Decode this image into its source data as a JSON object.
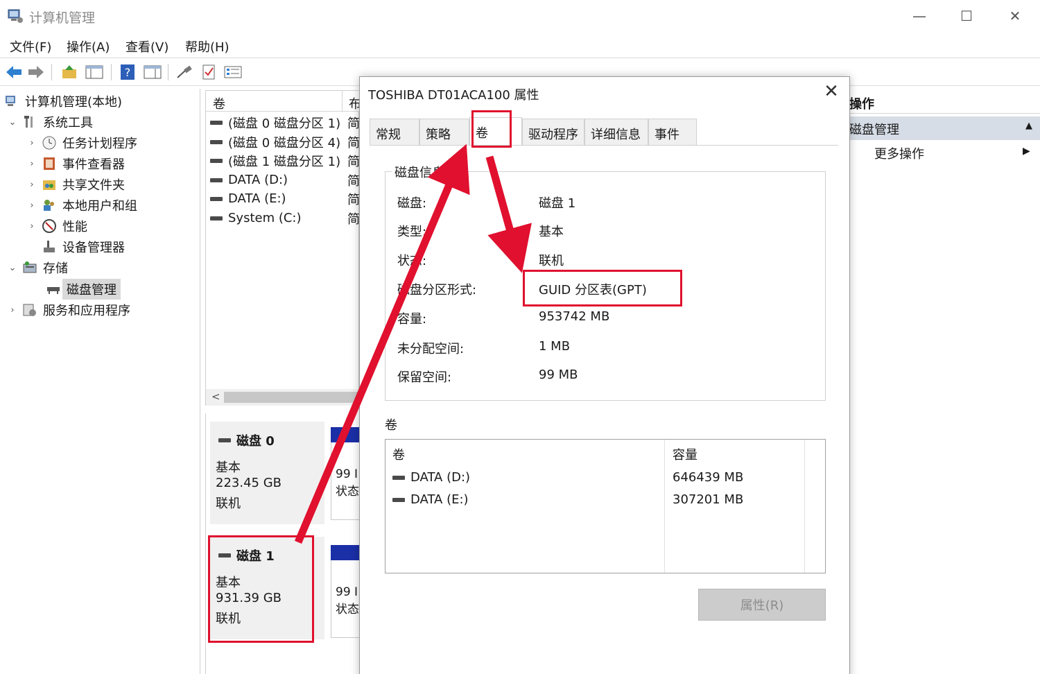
{
  "window": {
    "title": "计算机管理",
    "minimize": "—",
    "maximize": "☐",
    "close": "✕"
  },
  "menu": [
    "文件(F)",
    "操作(A)",
    "查看(V)",
    "帮助(H)"
  ],
  "tree": {
    "root": "计算机管理(本地)",
    "system_tools": "系统工具",
    "task_scheduler": "任务计划程序",
    "event_viewer": "事件查看器",
    "shared_folders": "共享文件夹",
    "local_users": "本地用户和组",
    "performance": "性能",
    "device_manager": "设备管理器",
    "storage": "存储",
    "disk_management": "磁盘管理",
    "services_apps": "服务和应用程序"
  },
  "volume_list": {
    "header_volume": "卷",
    "header_layout": "布",
    "rows": [
      {
        "name": "(磁盘 0 磁盘分区 1)",
        "layout": "简"
      },
      {
        "name": "(磁盘 0 磁盘分区 4)",
        "layout": "简"
      },
      {
        "name": "(磁盘 1 磁盘分区 1)",
        "layout": "简"
      },
      {
        "name": "DATA (D:)",
        "layout": "简"
      },
      {
        "name": "DATA (E:)",
        "layout": "简"
      },
      {
        "name": "System (C:)",
        "layout": "简"
      }
    ],
    "scroll_left": "<"
  },
  "disks": [
    {
      "name": "磁盘 0",
      "type": "基本",
      "size": "223.45 GB",
      "status": "联机",
      "part_size": "99 I",
      "part_status": "状态"
    },
    {
      "name": "磁盘 1",
      "type": "基本",
      "size": "931.39 GB",
      "status": "联机",
      "part_size": "99 I",
      "part_status": "状态"
    }
  ],
  "actions": {
    "header": "操作",
    "selected": "磁盘管理",
    "more": "更多操作",
    "collapse_glyph": "▲",
    "more_glyph": "▶"
  },
  "dialog": {
    "title": "TOSHIBA DT01ACA100 属性",
    "close": "✕",
    "tabs": [
      "常规",
      "策略",
      "卷",
      "驱动程序",
      "详细信息",
      "事件"
    ],
    "disk_info_title": "磁盘信息",
    "info": [
      {
        "key": "磁盘:",
        "value": "磁盘 1"
      },
      {
        "key": "类型:",
        "value": "基本"
      },
      {
        "key": "状态:",
        "value": "联机"
      },
      {
        "key": "磁盘分区形式:",
        "value": "GUID 分区表(GPT)"
      },
      {
        "key": "容量:",
        "value": "953742 MB"
      },
      {
        "key": "未分配空间:",
        "value": "1 MB"
      },
      {
        "key": "保留空间:",
        "value": "99 MB"
      }
    ],
    "volumes_title": "卷",
    "vol_table": {
      "col_volume": "卷",
      "col_capacity": "容量",
      "rows": [
        {
          "name": "DATA (D:)",
          "capacity": "646439 MB"
        },
        {
          "name": "DATA (E:)",
          "capacity": "307201 MB"
        }
      ]
    },
    "properties_button": "属性(R)"
  },
  "colors": {
    "highlight": "#e0102e",
    "partition_bar": "#1b2fa6",
    "selection": "#d6dde6"
  }
}
